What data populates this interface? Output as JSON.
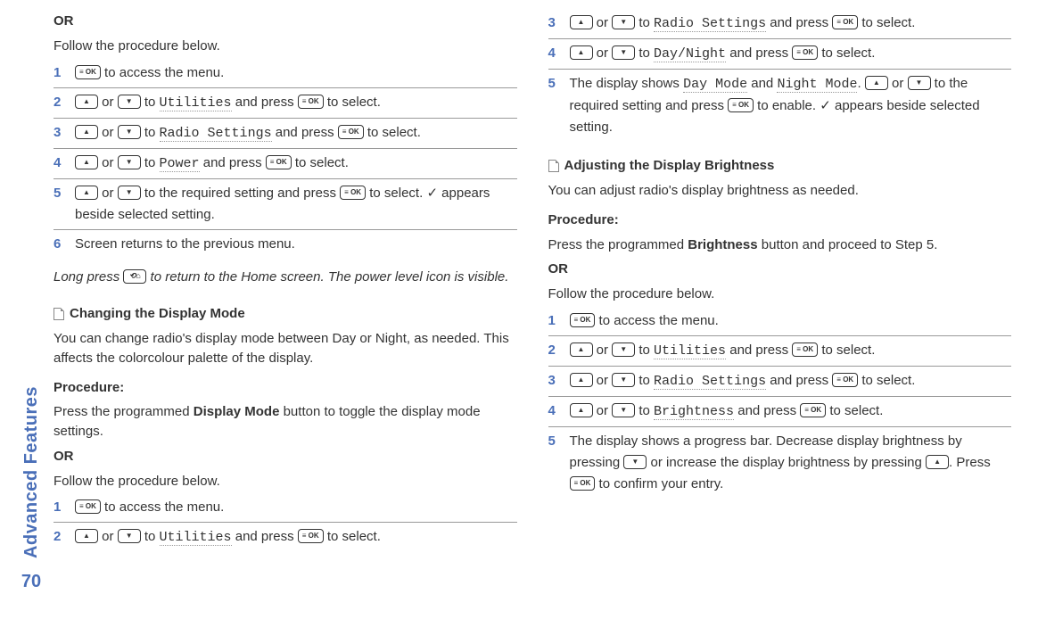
{
  "sidebar": {
    "section_label": "Advanced Features",
    "page_number": "70"
  },
  "left": {
    "or": "OR",
    "follow": "Follow the procedure below.",
    "steps_a": {
      "s1": {
        "num": "1",
        "tail": " to access the menu."
      },
      "s2": {
        "num": "2",
        "or": " or ",
        "to": " to ",
        "util": "Utilities",
        "press": " and press ",
        "sel": " to select."
      },
      "s3": {
        "num": "3",
        "or": " or ",
        "to": " to ",
        "rs": "Radio Settings",
        "press": " and press ",
        "sel": " to select."
      },
      "s4": {
        "num": "4",
        "or": " or ",
        "to": " to ",
        "pw": "Power",
        "press": " and press ",
        "sel": " to select."
      },
      "s5": {
        "num": "5",
        "or": " or ",
        "mid": " to the required setting and press ",
        "sel": " to select. ",
        "check": "✓",
        "tail": " appears beside selected setting."
      },
      "s6": {
        "num": "6",
        "text": "Screen returns to the previous menu."
      }
    },
    "long_press_pre": "Long press ",
    "long_press_post": " to return to the Home screen. The power level icon is visible.",
    "heading_b": "Changing the Display Mode",
    "desc_b": "You can change radio's display mode between Day or Night, as needed. This affects the colorcolour palette of the display.",
    "proc": "Procedure:",
    "proc_b1": "Press the programmed ",
    "proc_b_bold": "Display Mode",
    "proc_b2": " button to toggle the display mode settings.",
    "or2": "OR",
    "follow2": "Follow the procedure below.",
    "steps_b": {
      "s1": {
        "num": "1",
        "tail": " to access the menu."
      },
      "s2": {
        "num": "2",
        "or": " or ",
        "to": " to ",
        "util": "Utilities",
        "press": " and press ",
        "sel": " to select."
      }
    }
  },
  "right": {
    "steps_c": {
      "s3": {
        "num": "3",
        "or": " or ",
        "to": " to ",
        "rs": "Radio Settings",
        "press": " and press ",
        "sel": " to select."
      },
      "s4": {
        "num": "4",
        "or": " or ",
        "to": " to ",
        "dn": "Day/Night",
        "press": " and press ",
        "sel": " to select."
      },
      "s5": {
        "num": "5",
        "pre": "The display shows ",
        "dm": "Day Mode",
        "and": " and ",
        "nm": "Night Mode",
        "dot": ". ",
        "or": " or ",
        "mid": " to the required setting and press ",
        "en": " to enable. ",
        "check": "✓",
        "tail": " appears beside selected setting."
      }
    },
    "heading_d": "Adjusting the Display Brightness",
    "desc_d": "You can adjust radio's display brightness as needed.",
    "proc": "Procedure:",
    "proc_d1": "Press the programmed ",
    "proc_d_bold": "Brightness",
    "proc_d2": " button and proceed to Step 5.",
    "or3": "OR",
    "follow3": "Follow the procedure below.",
    "steps_d": {
      "s1": {
        "num": "1",
        "tail": " to access the menu."
      },
      "s2": {
        "num": "2",
        "or": " or ",
        "to": " to ",
        "util": "Utilities",
        "press": " and press ",
        "sel": " to select."
      },
      "s3": {
        "num": "3",
        "or": " or ",
        "to": " to ",
        "rs": "Radio Settings",
        "press": " and press ",
        "sel": " to select."
      },
      "s4": {
        "num": "4",
        "or": " or ",
        "to": " to ",
        "br": "Brightness",
        "press": " and press ",
        "sel": " to select."
      },
      "s5": {
        "num": "5",
        "pre": "The display shows a progress bar. Decrease display brightness by pressing ",
        "mid": " or increase the display brightness by pressing ",
        "post": ". Press ",
        "tail": " to confirm your entry."
      }
    }
  }
}
